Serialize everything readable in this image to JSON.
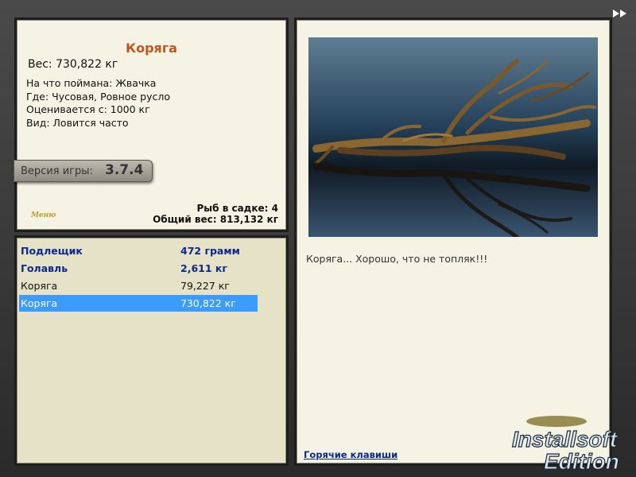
{
  "fish": {
    "name": "Коряга",
    "weight": "Вес: 730,822 кг",
    "caught_on": "На что поймана: Жвачка",
    "where": "Где: Чусовая, Ровное русло",
    "rated_from": "Оценивается с: 1000 кг",
    "kind": "Вид: Ловится часто"
  },
  "version": {
    "label": "Версия игры:",
    "number": "3.7.4"
  },
  "menu_label": "Меню",
  "stats": {
    "count": "Рыб в садке: 4",
    "total": "Общий вес: 813,132 кг"
  },
  "catch_list": [
    {
      "name": "Подлещик",
      "weight": "472 грамм"
    },
    {
      "name": "Голавль",
      "weight": "2,611 кг"
    },
    {
      "name": "Коряга",
      "weight": "79,227 кг"
    },
    {
      "name": "Коряга",
      "weight": "730,822 кг"
    }
  ],
  "selected_index": 3,
  "detail": {
    "caption": "Коряга... Хорошо, что не топляк!!!",
    "hotkeys_link": "Горячие клавиши"
  },
  "logo": {
    "line1": "Installsoft",
    "line2": "Edition"
  },
  "colors": {
    "title": "#c0561c",
    "link": "#0a2a8f",
    "selection": "#3b9bff",
    "panel": "#f5f3e3"
  },
  "icons": {
    "next": "double-arrow-right-icon"
  }
}
